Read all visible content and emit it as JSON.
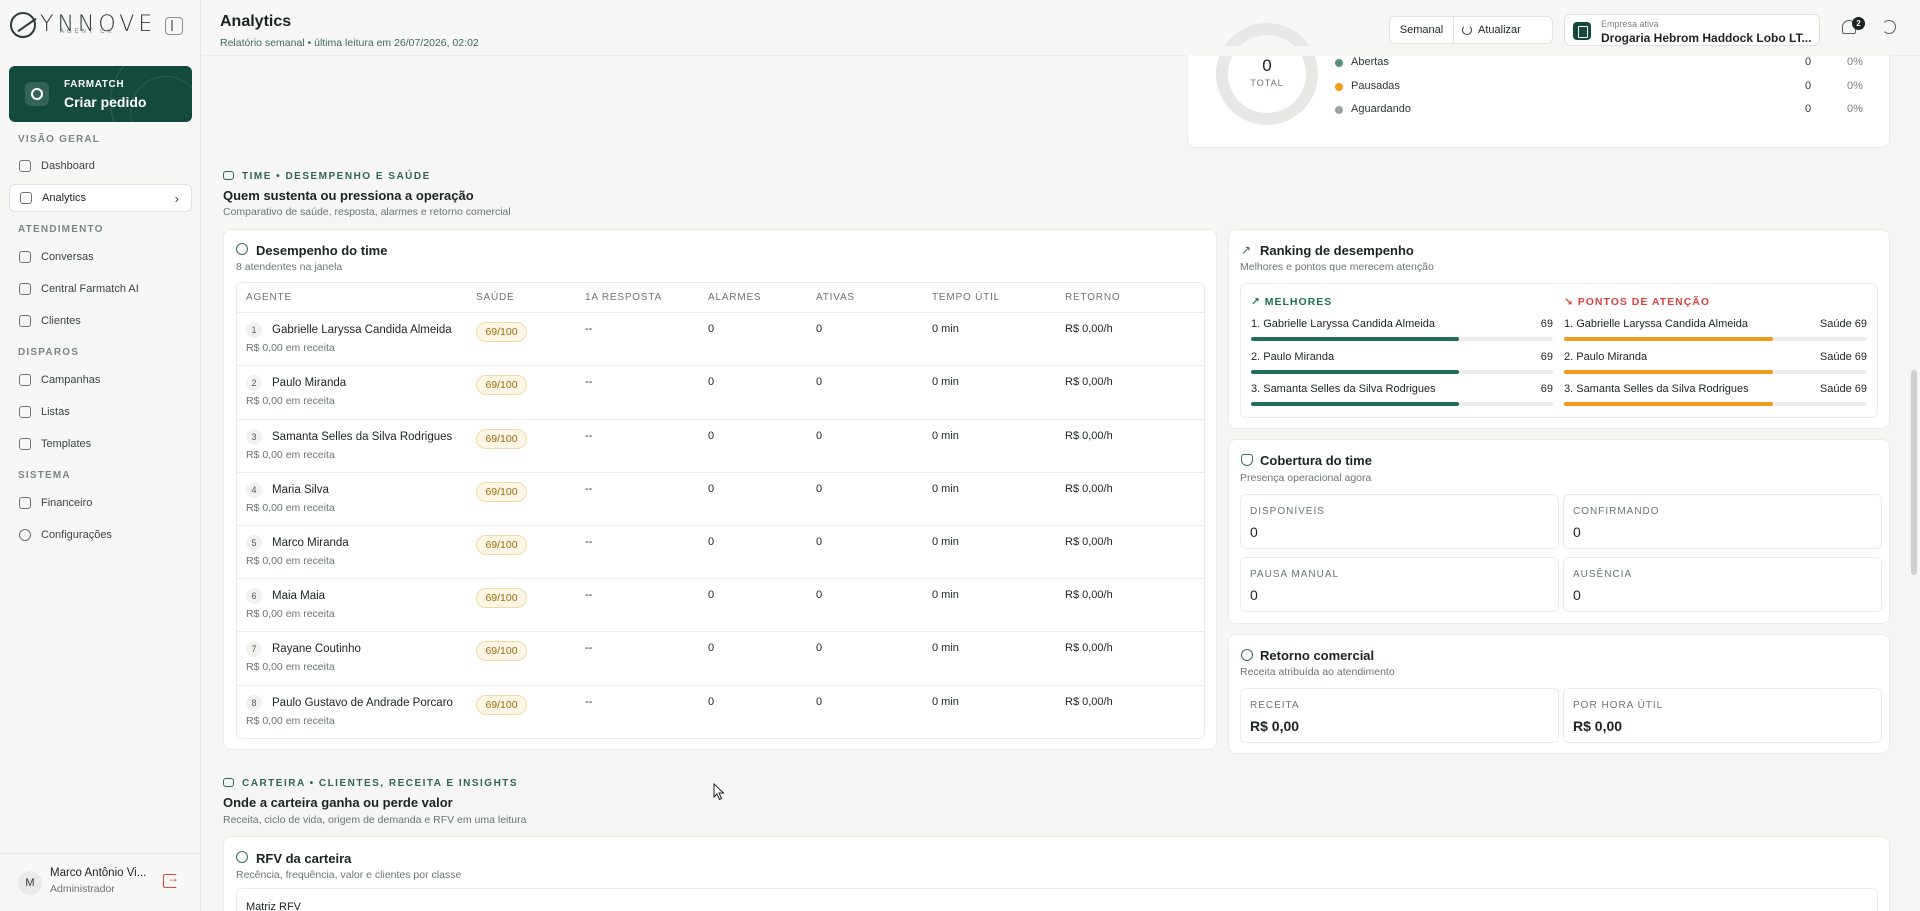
{
  "brand": {
    "name": "YNNOVE",
    "tagline": "AGENT CX"
  },
  "cta": {
    "small": "FARMATCH",
    "big": "Criar pedido"
  },
  "nav": {
    "sections": [
      {
        "title": "VISÃO GERAL",
        "items": [
          "Dashboard",
          "Analytics"
        ]
      },
      {
        "title": "ATENDIMENTO",
        "items": [
          "Conversas",
          "Central Farmatch AI",
          "Clientes"
        ]
      },
      {
        "title": "DISPAROS",
        "items": [
          "Campanhas",
          "Listas",
          "Templates"
        ]
      },
      {
        "title": "SISTEMA",
        "items": [
          "Financeiro",
          "Configurações"
        ]
      }
    ],
    "active": "Analytics"
  },
  "user": {
    "initial": "M",
    "name": "Marco Antônio Vi...",
    "role": "Administrador"
  },
  "header": {
    "title": "Analytics",
    "subtitle": "Relatório semanal • última leitura em 26/07/2026, 02:02",
    "period": "Semanal",
    "refresh": "Atualizar",
    "company_label": "Empresa ativa",
    "company_value": "Drogaria Hebrom Haddock Lobo LT...",
    "notifications": "2"
  },
  "status_card": {
    "total_value": "0",
    "total_label": "TOTAL",
    "legend": [
      {
        "label": "Abertas",
        "count": "0",
        "pct": "0%",
        "color": "#5a8f80"
      },
      {
        "label": "Pausadas",
        "count": "0",
        "pct": "0%",
        "color": "#f29a1a"
      },
      {
        "label": "Aguardando",
        "count": "0",
        "pct": "0%",
        "color": "#9aa29e"
      }
    ]
  },
  "team_section": {
    "eyebrow": "TIME • DESEMPENHO E SAÚDE",
    "title": "Quem sustenta ou pressiona a operação",
    "subtitle": "Comparativo de saúde, resposta, alarmes e retorno comercial"
  },
  "performance": {
    "title": "Desempenho do time",
    "subtitle": "8 atendentes na janela",
    "columns": [
      "AGENTE",
      "SAÚDE",
      "1A RESPOSTA",
      "ALARMES",
      "ATIVAS",
      "TEMPO ÚTIL",
      "RETORNO"
    ],
    "rows": [
      {
        "rank": "1",
        "name": "Gabrielle Laryssa Candida Almeida",
        "revenue": "R$ 0,00 em receita",
        "health": "69/100",
        "first_response": "--",
        "alarms": "0",
        "active": "0",
        "useful_time": "0 min",
        "return": "R$ 0,00/h"
      },
      {
        "rank": "2",
        "name": "Paulo Miranda",
        "revenue": "R$ 0,00 em receita",
        "health": "69/100",
        "first_response": "--",
        "alarms": "0",
        "active": "0",
        "useful_time": "0 min",
        "return": "R$ 0,00/h"
      },
      {
        "rank": "3",
        "name": "Samanta Selles da Silva Rodrigues",
        "revenue": "R$ 0,00 em receita",
        "health": "69/100",
        "first_response": "--",
        "alarms": "0",
        "active": "0",
        "useful_time": "0 min",
        "return": "R$ 0,00/h"
      },
      {
        "rank": "4",
        "name": "Maria Silva",
        "revenue": "R$ 0,00 em receita",
        "health": "69/100",
        "first_response": "--",
        "alarms": "0",
        "active": "0",
        "useful_time": "0 min",
        "return": "R$ 0,00/h"
      },
      {
        "rank": "5",
        "name": "Marco Miranda",
        "revenue": "R$ 0,00 em receita",
        "health": "69/100",
        "first_response": "--",
        "alarms": "0",
        "active": "0",
        "useful_time": "0 min",
        "return": "R$ 0,00/h"
      },
      {
        "rank": "6",
        "name": "Maia Maia",
        "revenue": "R$ 0,00 em receita",
        "health": "69/100",
        "first_response": "--",
        "alarms": "0",
        "active": "0",
        "useful_time": "0 min",
        "return": "R$ 0,00/h"
      },
      {
        "rank": "7",
        "name": "Rayane Coutinho",
        "revenue": "R$ 0,00 em receita",
        "health": "69/100",
        "first_response": "--",
        "alarms": "0",
        "active": "0",
        "useful_time": "0 min",
        "return": "R$ 0,00/h"
      },
      {
        "rank": "8",
        "name": "Paulo Gustavo de Andrade Porcaro",
        "revenue": "R$ 0,00 em receita",
        "health": "69/100",
        "first_response": "--",
        "alarms": "0",
        "active": "0",
        "useful_time": "0 min",
        "return": "R$ 0,00/h"
      }
    ]
  },
  "ranking": {
    "title": "Ranking de desempenho",
    "subtitle": "Melhores e pontos que merecem atenção",
    "best_title": "MELHORES",
    "attention_title": "PONTOS DE ATENÇÃO",
    "best": [
      {
        "label": "1. Gabrielle Laryssa Candida Almeida",
        "value": "69",
        "level": 0.69
      },
      {
        "label": "2. Paulo Miranda",
        "value": "69",
        "level": 0.69
      },
      {
        "label": "3. Samanta Selles da Silva Rodrigues",
        "value": "69",
        "level": 0.69
      }
    ],
    "attention": [
      {
        "label": "1. Gabrielle Laryssa Candida Almeida",
        "value": "Saúde 69",
        "level": 0.69
      },
      {
        "label": "2. Paulo Miranda",
        "value": "Saúde 69",
        "level": 0.69
      },
      {
        "label": "3. Samanta Selles da Silva Rodrigues",
        "value": "Saúde 69",
        "level": 0.69
      }
    ],
    "best_color": "#1f6e57",
    "attention_color": "#f29a1a"
  },
  "coverage": {
    "title": "Cobertura do time",
    "subtitle": "Presença operacional agora",
    "boxes": [
      {
        "label": "DISPONÍVEIS",
        "value": "0"
      },
      {
        "label": "CONFIRMANDO",
        "value": "0"
      },
      {
        "label": "PAUSA MANUAL",
        "value": "0"
      },
      {
        "label": "AUSÊNCIA",
        "value": "0"
      }
    ]
  },
  "commercial": {
    "title": "Retorno comercial",
    "subtitle": "Receita atribuída ao atendimento",
    "boxes": [
      {
        "label": "RECEITA",
        "value": "R$ 0,00"
      },
      {
        "label": "POR HORA ÚTIL",
        "value": "R$ 0,00"
      }
    ]
  },
  "portfolio_section": {
    "eyebrow": "CARTEIRA • CLIENTES, RECEITA E INSIGHTS",
    "title": "Onde a carteira ganha ou perde valor",
    "subtitle": "Receita, ciclo de vida, origem de demanda e RFV em uma leitura"
  },
  "rfv": {
    "title": "RFV da carteira",
    "subtitle": "Recência, frequência, valor e clientes por classe",
    "matrix_label": "Matriz RFV"
  }
}
